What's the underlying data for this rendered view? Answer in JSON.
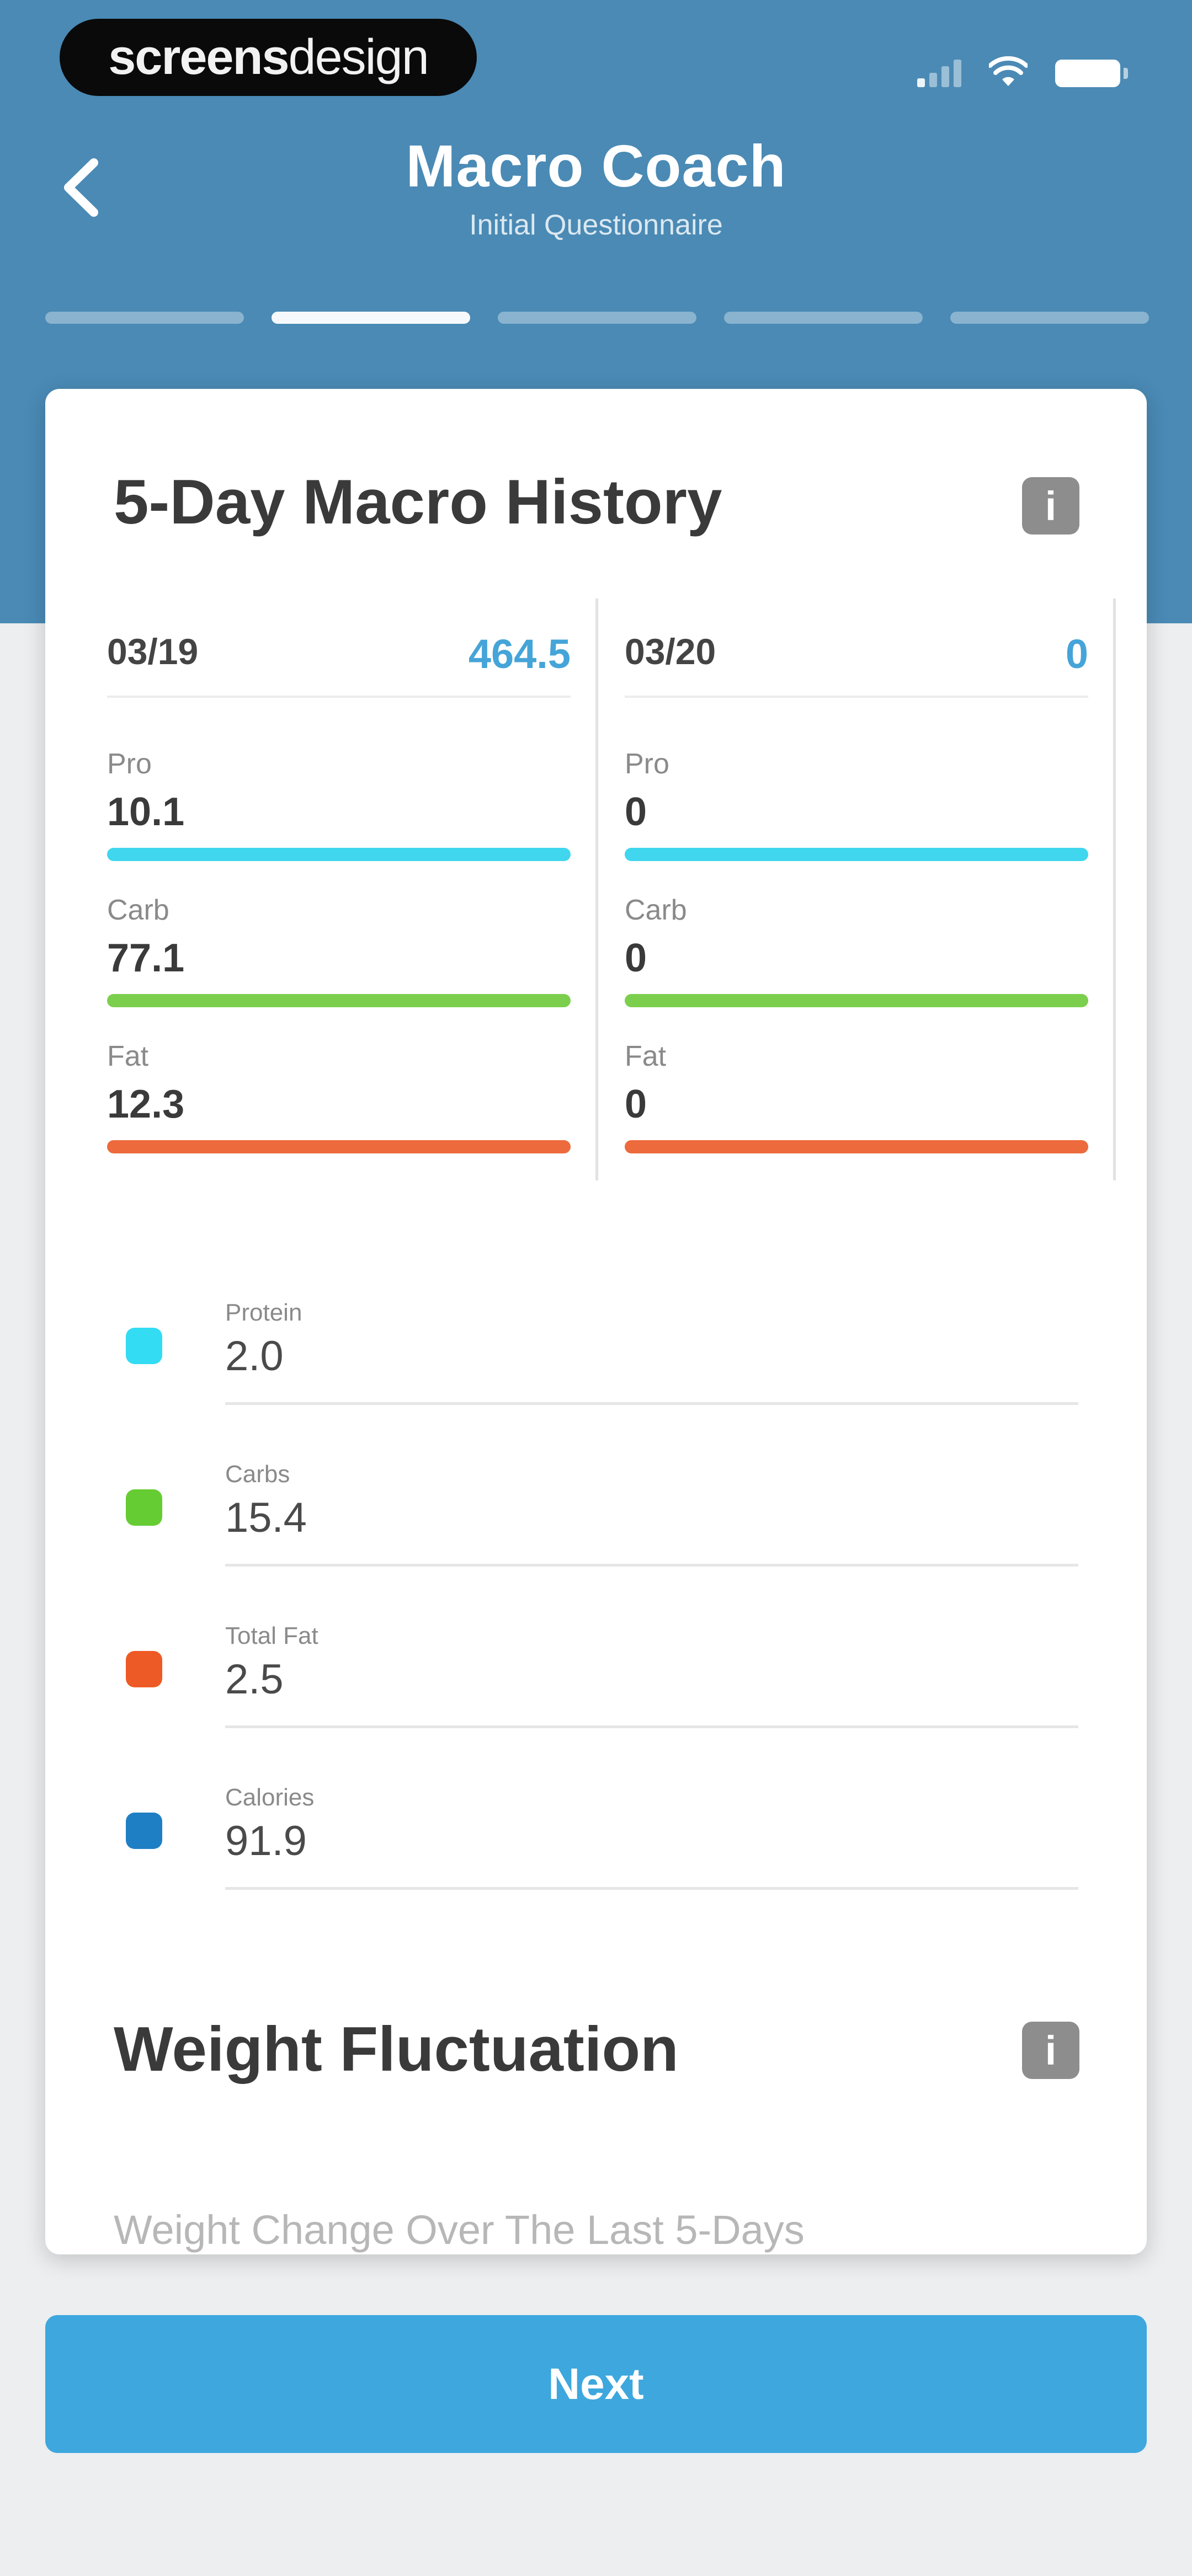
{
  "watermark": {
    "bold": "screens",
    "light": "design"
  },
  "header": {
    "title": "Macro Coach",
    "subtitle": "Initial Questionnaire",
    "progress": {
      "steps": 5,
      "active_step": 2
    }
  },
  "macro_history": {
    "title": "5-Day Macro History",
    "info_icon": "info-icon",
    "days": [
      {
        "date": "03/19",
        "total": "464.5",
        "macros": [
          {
            "label": "Pro",
            "value": "10.1",
            "color": "#3fd6ee"
          },
          {
            "label": "Carb",
            "value": "77.1",
            "color": "#7ccf4d"
          },
          {
            "label": "Fat",
            "value": "12.3",
            "color": "#ec6a3c"
          }
        ]
      },
      {
        "date": "03/20",
        "total": "0",
        "macros": [
          {
            "label": "Pro",
            "value": "0",
            "color": "#3fd6ee"
          },
          {
            "label": "Carb",
            "value": "0",
            "color": "#7ccf4d"
          },
          {
            "label": "Fat",
            "value": "0",
            "color": "#ec6a3c"
          }
        ]
      }
    ],
    "legend": [
      {
        "label": "Protein",
        "value": "2.0",
        "color": "#33dcf2"
      },
      {
        "label": "Carbs",
        "value": "15.4",
        "color": "#66cc33"
      },
      {
        "label": "Total Fat",
        "value": "2.5",
        "color": "#ee5a25"
      },
      {
        "label": "Calories",
        "value": "91.9",
        "color": "#1e7fc4"
      }
    ]
  },
  "weight": {
    "title": "Weight Fluctuation",
    "subtitle": "Weight Change Over The Last 5-Days"
  },
  "footer": {
    "next_label": "Next"
  }
}
